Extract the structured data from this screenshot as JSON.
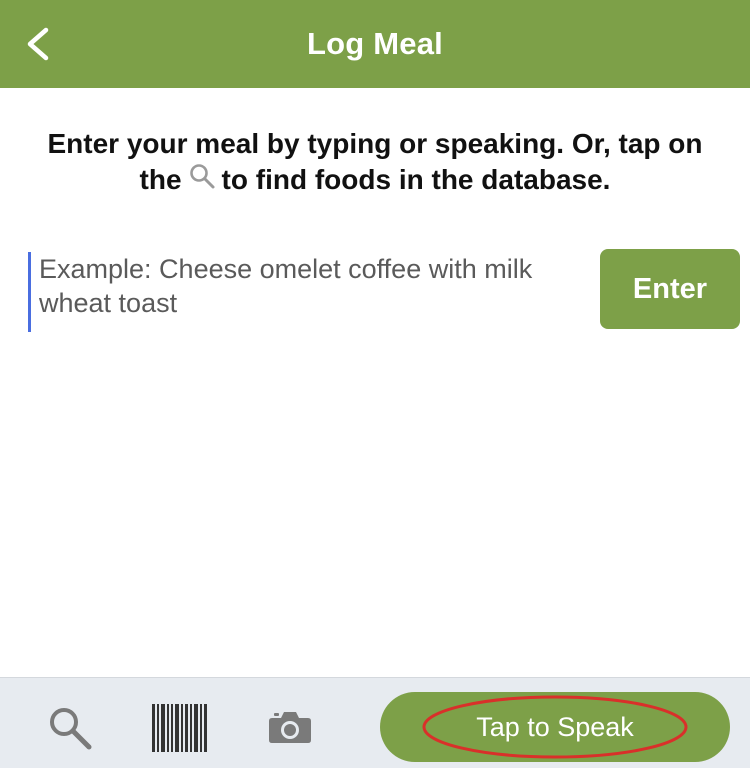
{
  "header": {
    "title": "Log Meal",
    "back_icon": "chevron-left-icon"
  },
  "instructions": {
    "line1": "Enter your meal by typing or speaking. Or, tap on",
    "line2_before": "the",
    "inline_icon": "search-icon",
    "line2_after": "to find foods in the database."
  },
  "meal_input": {
    "value": "",
    "placeholder": "Example: Cheese omelet coffee with milk wheat toast"
  },
  "enter_button": {
    "label": "Enter"
  },
  "toolbar": {
    "search_icon": "search-icon",
    "barcode_icon": "barcode-icon",
    "camera_icon": "camera-icon",
    "speak_label": "Tap to Speak"
  },
  "colors": {
    "accent_green": "#7da048",
    "toolbar_bg": "#e7ebf0",
    "highlight_red": "#d9302a",
    "icon_gray": "#7a7a7a",
    "cursor_blue": "#4a6ee0"
  }
}
